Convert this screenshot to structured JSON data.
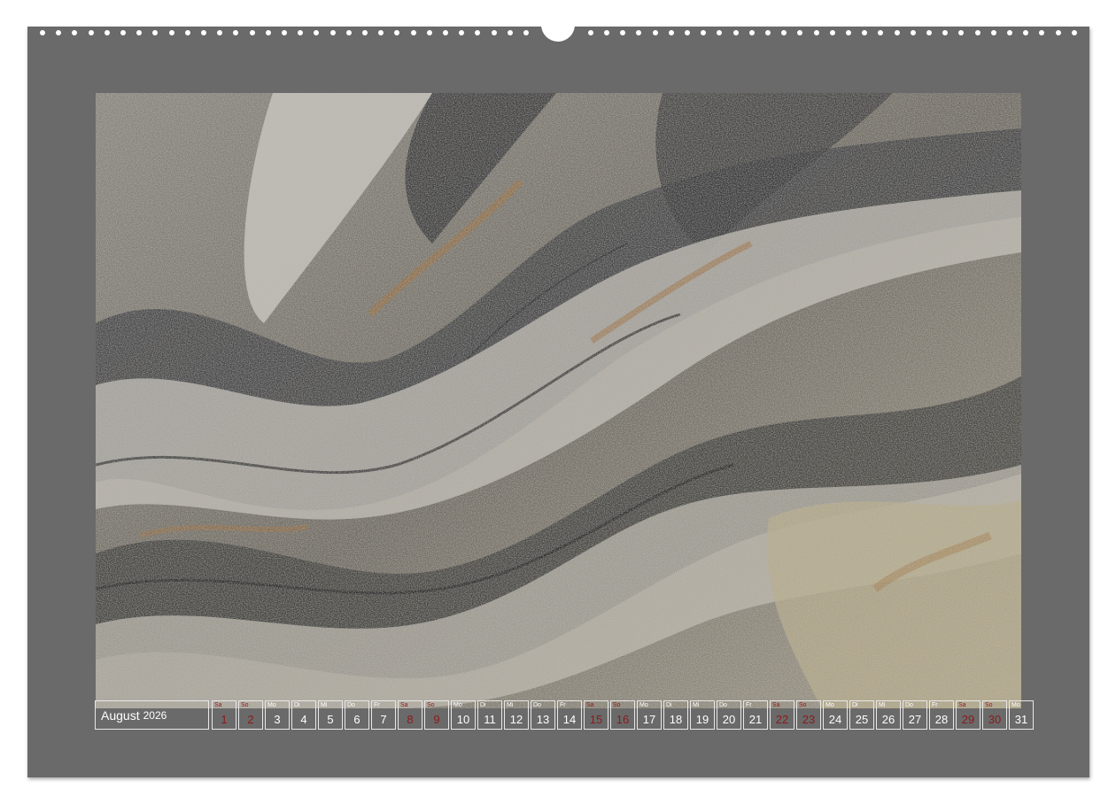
{
  "calendar": {
    "month": "August",
    "year": "2026",
    "days": [
      {
        "wd": "Sa",
        "n": "1",
        "we": true
      },
      {
        "wd": "So",
        "n": "2",
        "we": true
      },
      {
        "wd": "Mo",
        "n": "3",
        "we": false
      },
      {
        "wd": "Di",
        "n": "4",
        "we": false
      },
      {
        "wd": "Mi",
        "n": "5",
        "we": false
      },
      {
        "wd": "Do",
        "n": "6",
        "we": false
      },
      {
        "wd": "Fr",
        "n": "7",
        "we": false
      },
      {
        "wd": "Sa",
        "n": "8",
        "we": true
      },
      {
        "wd": "So",
        "n": "9",
        "we": true
      },
      {
        "wd": "Mo",
        "n": "10",
        "we": false
      },
      {
        "wd": "Di",
        "n": "11",
        "we": false
      },
      {
        "wd": "Mi",
        "n": "12",
        "we": false
      },
      {
        "wd": "Do",
        "n": "13",
        "we": false
      },
      {
        "wd": "Fr",
        "n": "14",
        "we": false
      },
      {
        "wd": "Sa",
        "n": "15",
        "we": true
      },
      {
        "wd": "So",
        "n": "16",
        "we": true
      },
      {
        "wd": "Mo",
        "n": "17",
        "we": false
      },
      {
        "wd": "Di",
        "n": "18",
        "we": false
      },
      {
        "wd": "Mi",
        "n": "19",
        "we": false
      },
      {
        "wd": "Do",
        "n": "20",
        "we": false
      },
      {
        "wd": "Fr",
        "n": "21",
        "we": false
      },
      {
        "wd": "Sa",
        "n": "22",
        "we": true
      },
      {
        "wd": "So",
        "n": "23",
        "we": true
      },
      {
        "wd": "Mo",
        "n": "24",
        "we": false
      },
      {
        "wd": "Di",
        "n": "25",
        "we": false
      },
      {
        "wd": "Mi",
        "n": "26",
        "we": false
      },
      {
        "wd": "Do",
        "n": "27",
        "we": false
      },
      {
        "wd": "Fr",
        "n": "28",
        "we": false
      },
      {
        "wd": "Sa",
        "n": "29",
        "we": true
      },
      {
        "wd": "So",
        "n": "30",
        "we": true
      },
      {
        "wd": "Mo",
        "n": "31",
        "we": false
      }
    ]
  },
  "colors": {
    "page_background": "#6a6a6a",
    "weekend_text": "#8c1a1a",
    "weekday_text": "#ffffff"
  }
}
